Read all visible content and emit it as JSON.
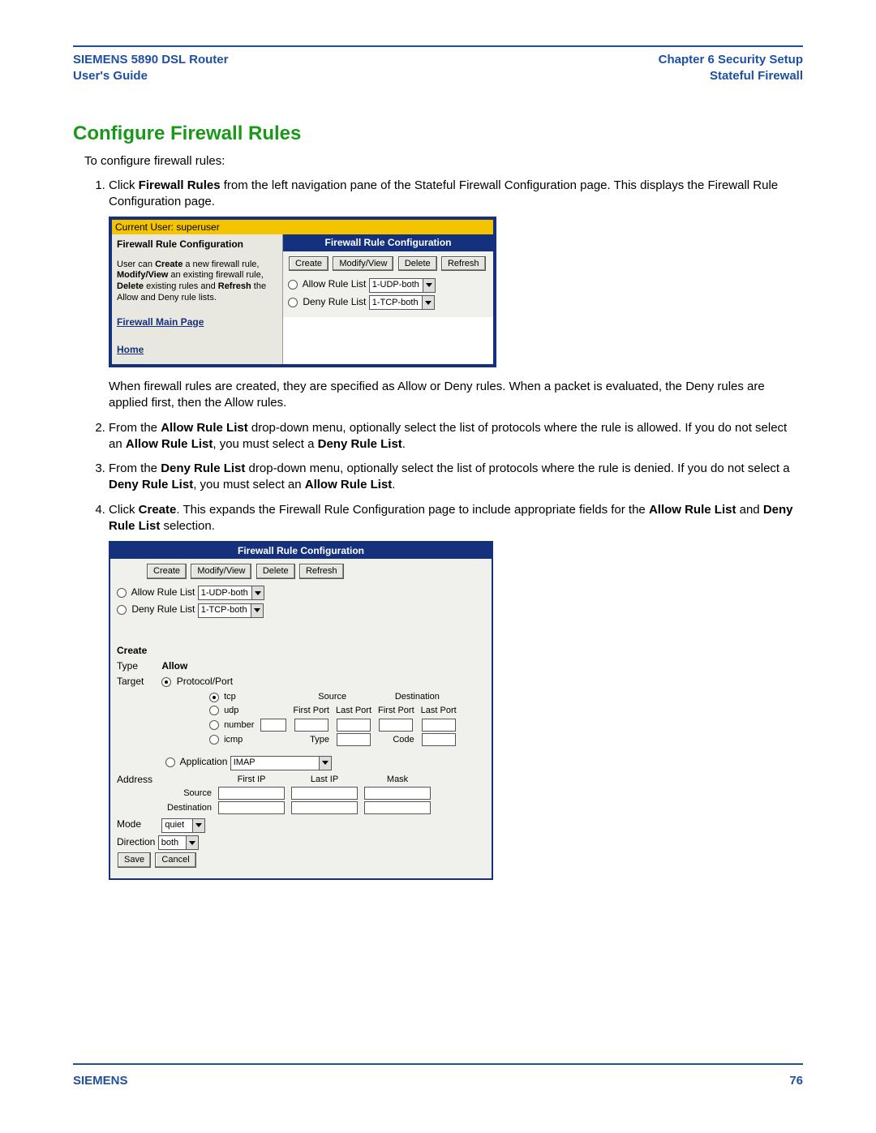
{
  "header": {
    "left_line1": "SIEMENS 5890 DSL Router",
    "left_line2": "User's Guide",
    "right_line1": "Chapter 6  Security Setup",
    "right_line2": "Stateful Firewall"
  },
  "section_title": "Configure Firewall Rules",
  "intro": "To configure firewall rules:",
  "steps": {
    "s1a": "Click ",
    "s1b": "Firewall Rules",
    "s1c": " from the left navigation pane of the Stateful Firewall Configuration page. This displays the Firewall Rule Configuration page.",
    "s1_after": "When firewall rules are created, they are specified as Allow or Deny rules. When a packet is evaluated, the Deny rules are applied first, then the Allow rules.",
    "s2a": "From the ",
    "s2b": "Allow Rule List",
    "s2c": " drop-down menu, optionally select the list of protocols where the rule is allowed. If you do not select an ",
    "s2d": "Allow Rule List",
    "s2e": ", you must select a ",
    "s2f": "Deny Rule List",
    "s2g": ".",
    "s3a": "From the ",
    "s3b": "Deny Rule List",
    "s3c": " drop-down menu, optionally select the list of protocols where the rule is denied. If you do not select a ",
    "s3d": "Deny Rule List",
    "s3e": ", you must select an ",
    "s3f": "Allow Rule List",
    "s3g": ".",
    "s4a": "Click ",
    "s4b": "Create",
    "s4c": ". This expands the Firewall Rule Configuration page to include appropriate fields for the ",
    "s4d": "Allow Rule List",
    "s4e": " and ",
    "s4f": "Deny Rule List",
    "s4g": " selection."
  },
  "shot1": {
    "userbar": "Current User: superuser",
    "side_title": "Firewall Rule Configuration",
    "side_desc_a": "User can ",
    "side_desc_b": "Create",
    "side_desc_c": " a new firewall rule, ",
    "side_desc_d": "Modify/View",
    "side_desc_e": " an existing firewall rule, ",
    "side_desc_f": "Delete",
    "side_desc_g": " existing rules and ",
    "side_desc_h": "Refresh",
    "side_desc_i": " the Allow and Deny rule lists.",
    "link_main": "Firewall Main Page",
    "link_home": "Home",
    "panel_title": "Firewall Rule Configuration",
    "btn_create": "Create",
    "btn_modify": "Modify/View",
    "btn_delete": "Delete",
    "btn_refresh": "Refresh",
    "allow_label": "Allow Rule List",
    "allow_value": "1-UDP-both",
    "deny_label": "Deny Rule List",
    "deny_value": "1-TCP-both"
  },
  "shot2": {
    "panel_title": "Firewall Rule Configuration",
    "btn_create": "Create",
    "btn_modify": "Modify/View",
    "btn_delete": "Delete",
    "btn_refresh": "Refresh",
    "allow_label": "Allow Rule List",
    "allow_value": "1-UDP-both",
    "deny_label": "Deny Rule List",
    "deny_value": "1-TCP-both",
    "create_hdr": "Create",
    "type_label": "Type",
    "type_value": "Allow",
    "target_label": "Target",
    "target_protocol": "Protocol/Port",
    "proto_tcp": "tcp",
    "proto_udp": "udp",
    "proto_number": "number",
    "proto_icmp": "icmp",
    "col_source": "Source",
    "col_dest": "Destination",
    "lbl_firstport": "First Port",
    "lbl_lastport": "Last Port",
    "lbl_type": "Type",
    "lbl_code": "Code",
    "target_application": "Application",
    "app_value": "IMAP",
    "address_label": "Address",
    "addr_firstip": "First IP",
    "addr_lastip": "Last IP",
    "addr_mask": "Mask",
    "addr_source": "Source",
    "addr_dest": "Destination",
    "mode_label": "Mode",
    "mode_value": "quiet",
    "direction_label": "Direction",
    "direction_value": "both",
    "btn_save": "Save",
    "btn_cancel": "Cancel"
  },
  "footer": {
    "left": "SIEMENS",
    "right": "76"
  }
}
